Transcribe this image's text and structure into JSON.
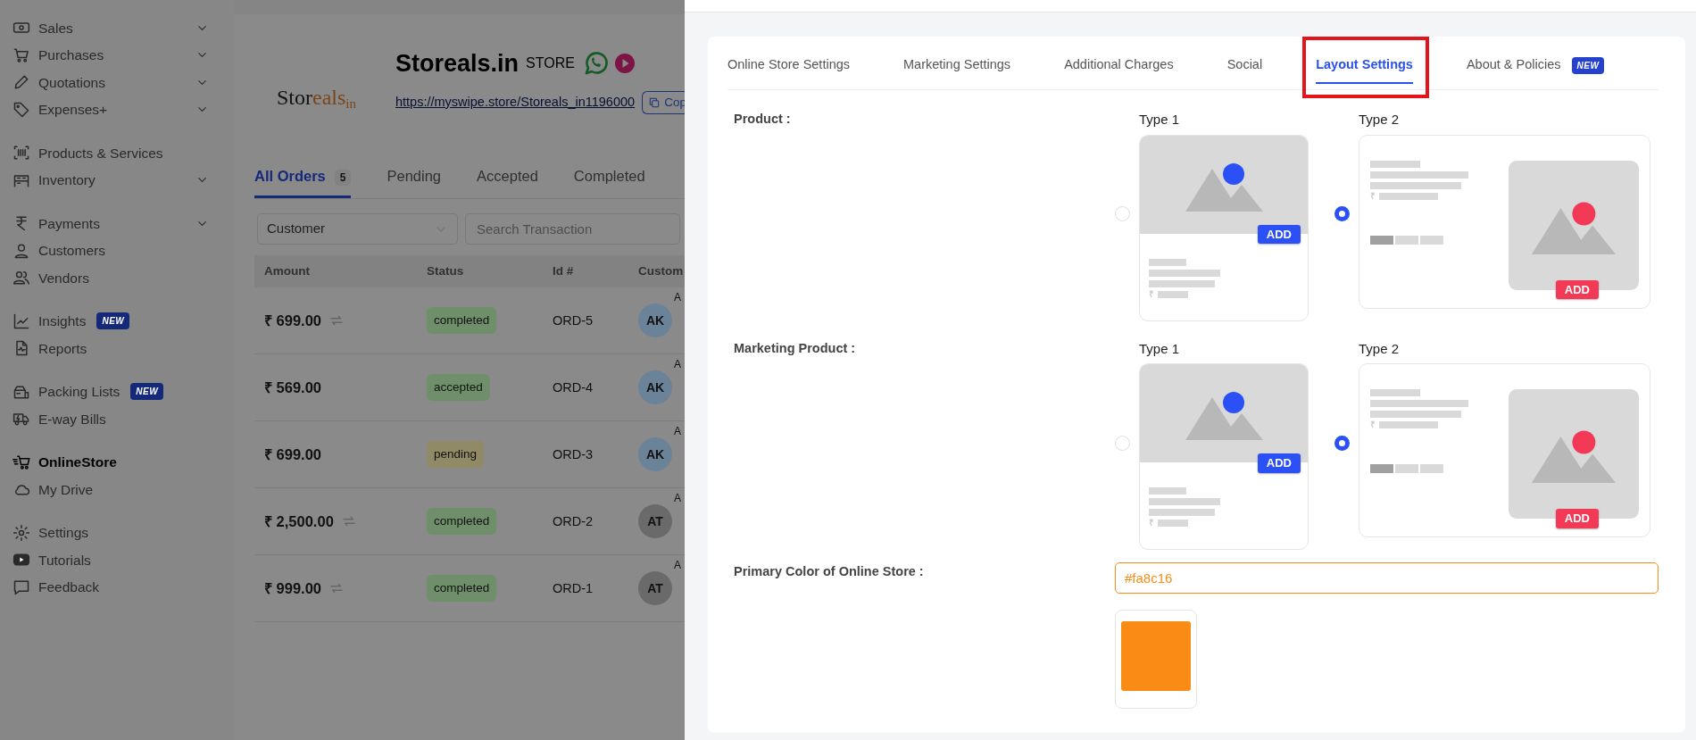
{
  "sidebar": {
    "groups": [
      [
        {
          "label": "Sales",
          "expandable": true,
          "selected": false
        },
        {
          "label": "Purchases",
          "expandable": true,
          "selected": false
        },
        {
          "label": "Quotations",
          "expandable": true,
          "selected": false
        },
        {
          "label": "Expenses+",
          "expandable": true,
          "selected": false
        }
      ],
      [
        {
          "label": "Products & Services",
          "expandable": false,
          "selected": false
        },
        {
          "label": "Inventory",
          "expandable": true,
          "selected": false
        }
      ],
      [
        {
          "label": "Payments",
          "expandable": true,
          "selected": false
        },
        {
          "label": "Customers",
          "expandable": false,
          "selected": false
        },
        {
          "label": "Vendors",
          "expandable": false,
          "selected": false
        }
      ],
      [
        {
          "label": "Insights",
          "expandable": false,
          "selected": false,
          "badge": "NEW"
        },
        {
          "label": "Reports",
          "expandable": false,
          "selected": false
        }
      ],
      [
        {
          "label": "Packing Lists",
          "expandable": false,
          "selected": false,
          "badge": "NEW"
        },
        {
          "label": "E-way Bills",
          "expandable": false,
          "selected": false
        }
      ],
      [
        {
          "label": "OnlineStore",
          "expandable": false,
          "selected": true
        },
        {
          "label": "My Drive",
          "expandable": false,
          "selected": false
        }
      ],
      [
        {
          "label": "Settings",
          "expandable": false,
          "selected": false
        },
        {
          "label": "Tutorials",
          "expandable": false,
          "selected": false
        },
        {
          "label": "Feedback",
          "expandable": false,
          "selected": false
        }
      ]
    ]
  },
  "store": {
    "logo": {
      "main": "Stor",
      "accent": "eals",
      "suffix": "in"
    },
    "name": "Storeals.in",
    "suffix": "STORE",
    "url": "https://myswipe.store/Storeals_in1196000",
    "copy_button": "Cop"
  },
  "order_tabs": [
    {
      "label": "All Orders",
      "count": "5",
      "selected": true
    },
    {
      "label": "Pending",
      "selected": false
    },
    {
      "label": "Accepted",
      "selected": false
    },
    {
      "label": "Completed",
      "selected": false
    }
  ],
  "filters": {
    "customer_select": "Customer",
    "search_placeholder": "Search Transaction"
  },
  "table": {
    "columns": [
      "Amount",
      "Status",
      "Id #",
      "Custom"
    ],
    "rows": [
      {
        "amount": "₹ 699.00",
        "recurring": true,
        "status": {
          "label": "completed",
          "color": "#6f8f6a"
        },
        "id": "ORD-5",
        "avatar": {
          "initials": "AK",
          "color": "#6b8399"
        },
        "customer": "A"
      },
      {
        "amount": "₹ 569.00",
        "recurring": false,
        "status": {
          "label": "accepted",
          "color": "#6f8f6a"
        },
        "id": "ORD-4",
        "avatar": {
          "initials": "AK",
          "color": "#6b8399"
        },
        "customer": "A"
      },
      {
        "amount": "₹ 699.00",
        "recurring": false,
        "status": {
          "label": "pending",
          "color": "#908a66"
        },
        "id": "ORD-3",
        "avatar": {
          "initials": "AK",
          "color": "#6b8399"
        },
        "customer": "A"
      },
      {
        "amount": "₹ 2,500.00",
        "recurring": true,
        "status": {
          "label": "completed",
          "color": "#6f8f6a"
        },
        "id": "ORD-2",
        "avatar": {
          "initials": "AT",
          "color": "#6a6a6a"
        },
        "customer": "A"
      },
      {
        "amount": "₹ 999.00",
        "recurring": true,
        "status": {
          "label": "completed",
          "color": "#6f8f6a"
        },
        "id": "ORD-1",
        "avatar": {
          "initials": "AT",
          "color": "#6a6a6a"
        },
        "customer": "A"
      }
    ]
  },
  "settings_tabs": [
    {
      "label": "Online Store Settings",
      "selected": false,
      "highlighted": false
    },
    {
      "label": "Marketing Settings",
      "selected": false,
      "highlighted": false
    },
    {
      "label": "Additional Charges",
      "selected": false,
      "highlighted": false
    },
    {
      "label": "Social",
      "selected": false,
      "highlighted": false
    },
    {
      "label": "Layout Settings",
      "selected": true,
      "highlighted": true
    },
    {
      "label": "About & Policies",
      "selected": false,
      "highlighted": false,
      "badge": "NEW"
    }
  ],
  "layouts": [
    {
      "label": "Product :",
      "options": [
        {
          "label": "Type 1",
          "kind": "grid",
          "selected": false,
          "add_label": "ADD",
          "currency": "₹"
        },
        {
          "label": "Type 2",
          "kind": "list",
          "selected": true,
          "add_label": "ADD",
          "currency": "₹"
        }
      ]
    },
    {
      "label": "Marketing Product :",
      "options": [
        {
          "label": "Type 1",
          "kind": "grid",
          "selected": false,
          "add_label": "ADD",
          "currency": "₹"
        },
        {
          "label": "Type 2",
          "kind": "list",
          "selected": true,
          "add_label": "ADD",
          "currency": "₹"
        }
      ]
    }
  ],
  "primary_color": {
    "label": "Primary Color of Online Store :",
    "value": "#fa8c16"
  }
}
